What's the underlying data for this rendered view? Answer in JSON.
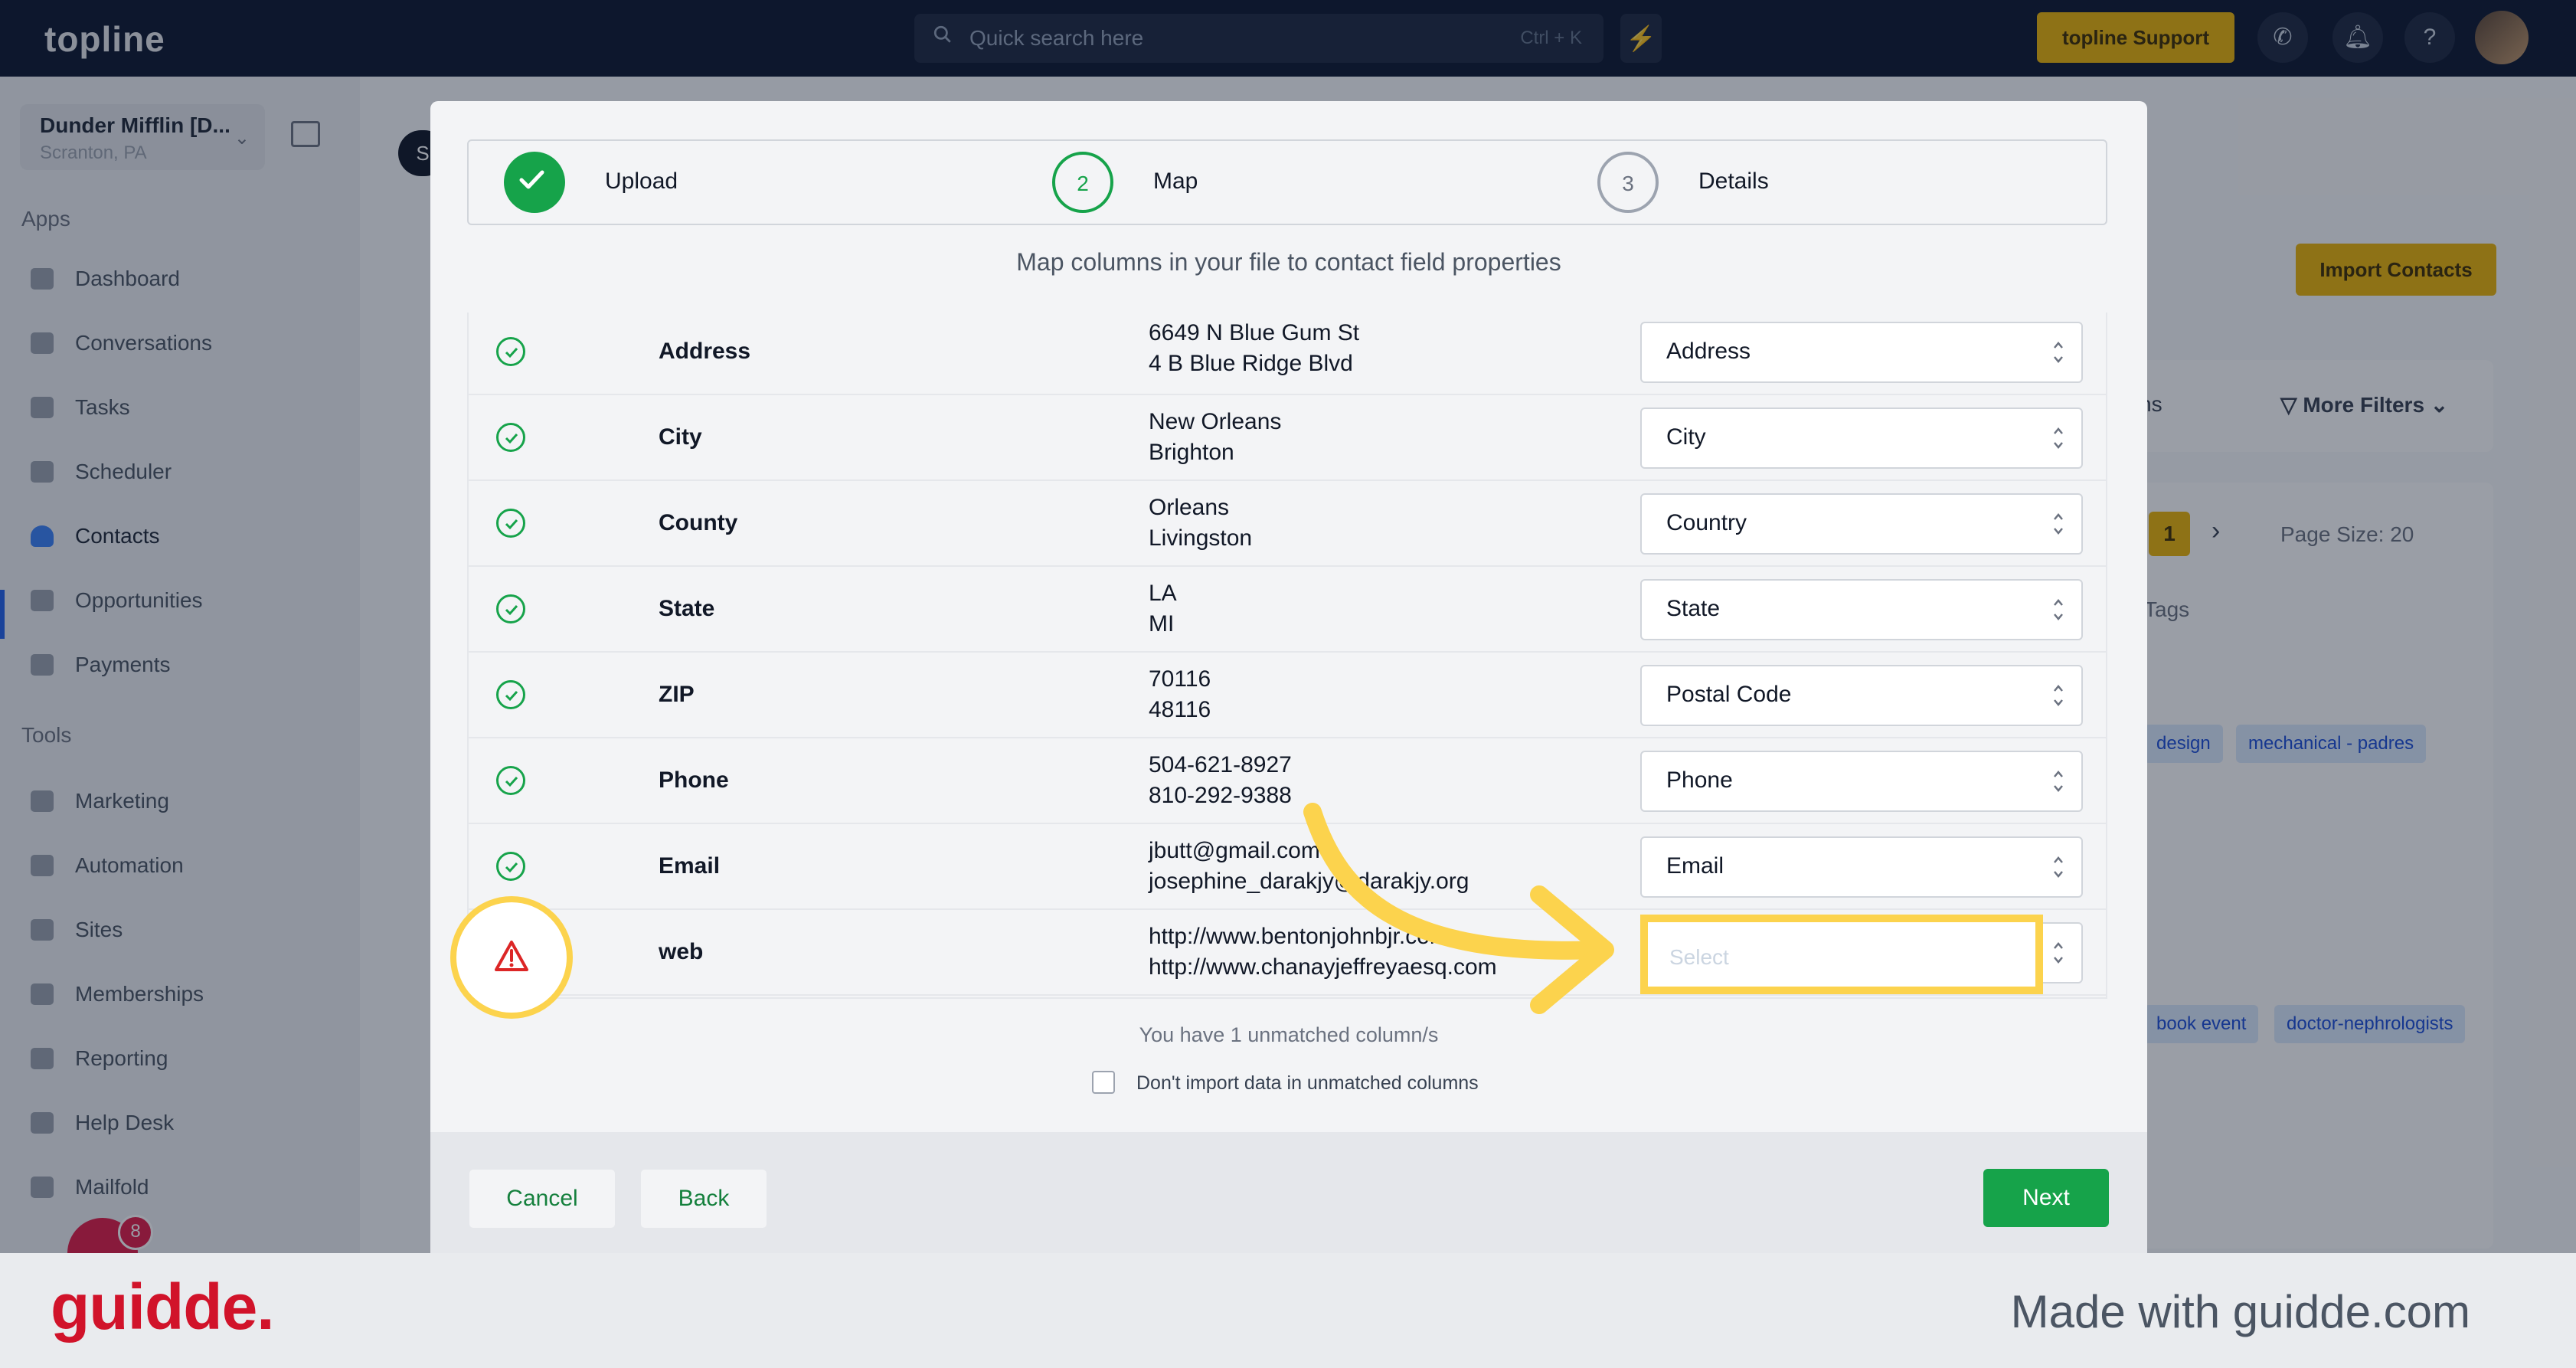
{
  "topbar": {
    "logo": "topline",
    "search_placeholder": "Quick search here",
    "search_shortcut": "Ctrl + K",
    "support_label": "topline Support"
  },
  "sidebar": {
    "account_name": "Dunder Mifflin [D...",
    "account_location": "Scranton, PA",
    "apps_label": "Apps",
    "apps": [
      {
        "label": "Dashboard"
      },
      {
        "label": "Conversations"
      },
      {
        "label": "Tasks"
      },
      {
        "label": "Scheduler"
      },
      {
        "label": "Contacts"
      },
      {
        "label": "Opportunities"
      },
      {
        "label": "Payments"
      }
    ],
    "tools_label": "Tools",
    "tools": [
      {
        "label": "Marketing"
      },
      {
        "label": "Automation"
      },
      {
        "label": "Sites"
      },
      {
        "label": "Memberships"
      },
      {
        "label": "Reporting"
      },
      {
        "label": "Help Desk"
      },
      {
        "label": "Mailfold"
      }
    ],
    "notification_count": "8"
  },
  "background": {
    "s_pill": "S",
    "import_contacts": "Import Contacts",
    "columns_fragment": "ns",
    "more_filters": "More Filters",
    "current_page": "1",
    "page_size": "Page Size: 20",
    "tags_header": "Tags",
    "tags_row1": [
      "design",
      "mechanical - padres"
    ],
    "tags_row2": [
      "book event",
      "doctor-nephrologists"
    ]
  },
  "modal": {
    "steps": [
      {
        "number": "",
        "label": "Upload",
        "state": "done"
      },
      {
        "number": "2",
        "label": "Map",
        "state": "current"
      },
      {
        "number": "3",
        "label": "Details",
        "state": "todo"
      }
    ],
    "subtitle": "Map columns in your file to contact field properties",
    "rows": [
      {
        "column": "Address",
        "values": [
          "6649 N Blue Gum St",
          "4 B Blue Ridge Blvd"
        ],
        "mapped": "Address",
        "matched": true
      },
      {
        "column": "City",
        "values": [
          "New Orleans",
          "Brighton"
        ],
        "mapped": "City",
        "matched": true
      },
      {
        "column": "County",
        "values": [
          "Orleans",
          "Livingston"
        ],
        "mapped": "Country",
        "matched": true
      },
      {
        "column": "State",
        "values": [
          "LA",
          "MI"
        ],
        "mapped": "State",
        "matched": true
      },
      {
        "column": "ZIP",
        "values": [
          "70116",
          "48116"
        ],
        "mapped": "Postal Code",
        "matched": true
      },
      {
        "column": "Phone",
        "values": [
          "504-621-8927",
          "810-292-9388"
        ],
        "mapped": "Phone",
        "matched": true
      },
      {
        "column": "Email",
        "values": [
          "jbutt@gmail.com",
          "josephine_darakjy@darakjy.org"
        ],
        "mapped": "Email",
        "matched": true
      },
      {
        "column": "web",
        "values": [
          "http://www.bentonjohnbjr.com",
          "http://www.chanayjeffreyaesq.com"
        ],
        "mapped": "",
        "matched": false
      }
    ],
    "select_placeholder": "Select",
    "unmatched_text": "You have 1 unmatched column/s",
    "dont_import_label": "Don't import data in unmatched columns",
    "cancel_label": "Cancel",
    "back_label": "Back",
    "next_label": "Next"
  },
  "footer": {
    "brand": "guidde.",
    "made_with": "Made with guidde.com"
  },
  "colors": {
    "accent_green": "#16a34a",
    "highlight_yellow": "#fcd34d",
    "brand_red": "#d1132a",
    "topbar_navy": "#0d1730"
  }
}
